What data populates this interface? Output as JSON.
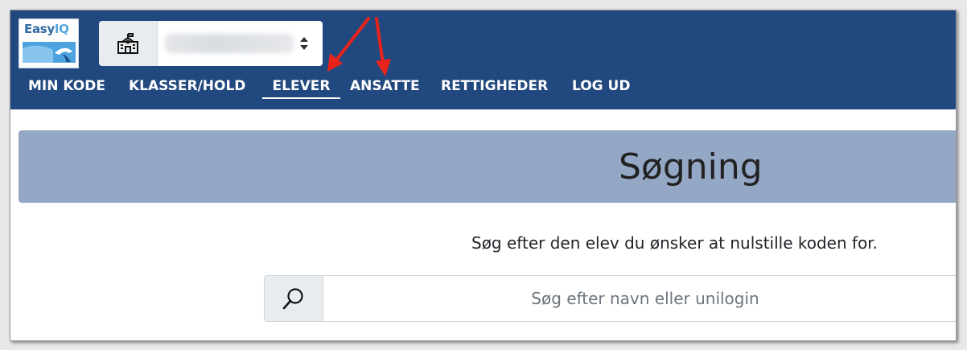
{
  "app": {
    "logo_text_main": "Easy",
    "logo_text_accent": "IQ"
  },
  "school_selector": {
    "icon": "school-icon",
    "value": ""
  },
  "nav": {
    "items": [
      {
        "label": "MIN KODE"
      },
      {
        "label": "KLASSER/HOLD"
      },
      {
        "label": "ELEVER",
        "active": true
      },
      {
        "label": "ANSATTE"
      },
      {
        "label": "RETTIGHEDER"
      },
      {
        "label": "LOG UD"
      }
    ]
  },
  "search": {
    "title": "Søgning",
    "instruction": "Søg efter den elev du ønsker at nulstille koden for.",
    "placeholder": "Søg efter navn eller unilogin",
    "icon": "search-icon"
  },
  "colors": {
    "header_bg": "#22497f",
    "banner_bg": "#94a8c6",
    "annotation_arrow": "#e8231c"
  }
}
